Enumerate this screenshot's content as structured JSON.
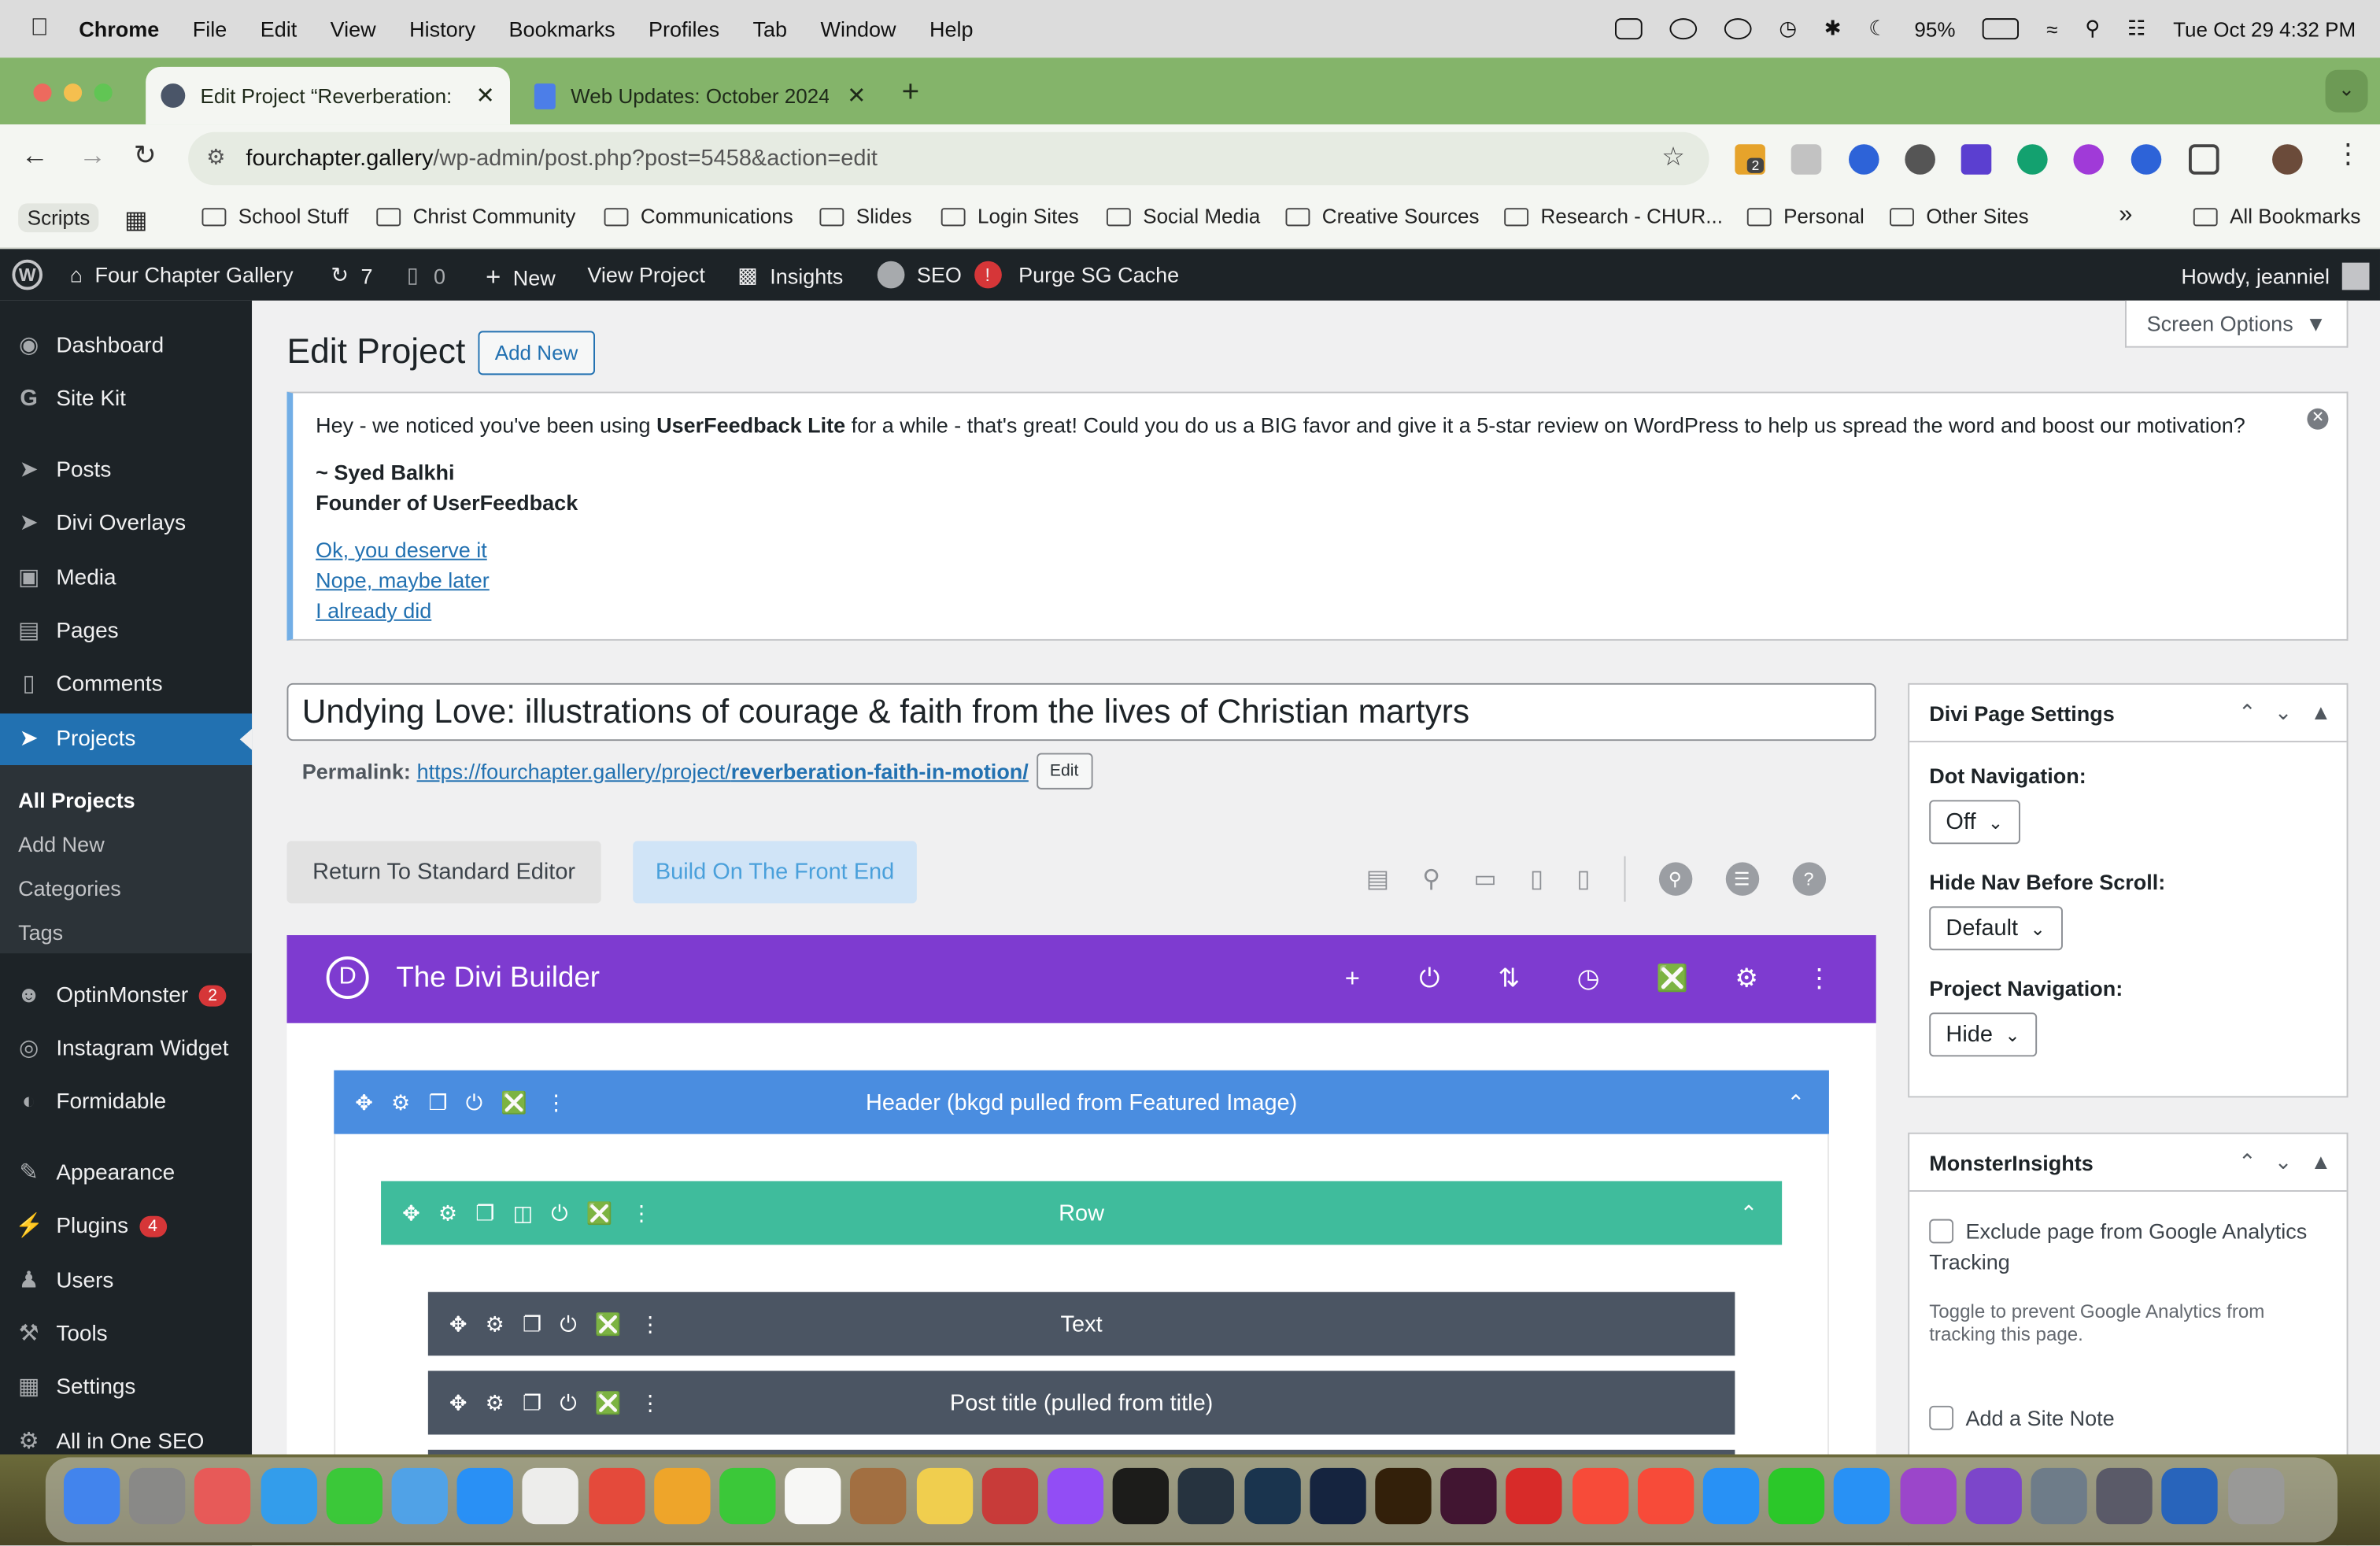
{
  "macos": {
    "app": "Chrome",
    "menus": [
      "File",
      "Edit",
      "View",
      "History",
      "Bookmarks",
      "Profiles",
      "Tab",
      "Window",
      "Help"
    ],
    "battery": "95%",
    "clock": "Tue Oct 29  4:32 PM"
  },
  "browser": {
    "tabs": [
      {
        "title": "Edit Project “Reverberation: F"
      },
      {
        "title": "Web Updates: October 2024"
      }
    ],
    "url_host": "fourchapter.gallery",
    "url_path": "/wp-admin/post.php?post=5458&action=edit",
    "ext_badge": "2",
    "bookmarks": [
      "School Stuff",
      "Christ Community",
      "Communications",
      "Slides",
      "Login Sites",
      "Social Media",
      "Creative Sources",
      "Research - CHUR...",
      "Personal",
      "Other Sites"
    ],
    "scripts_label": "Scripts",
    "more": "»",
    "all_bookmarks": "All Bookmarks"
  },
  "adminbar": {
    "site_name": "Four Chapter Gallery",
    "updates": "7",
    "comments": "0",
    "new": "New",
    "view_project": "View Project",
    "insights": "Insights",
    "seo": "SEO",
    "seo_alert": "!",
    "purge": "Purge SG Cache",
    "howdy": "Howdy, jeanniel"
  },
  "sidebar": {
    "items": [
      {
        "label": "Dashboard",
        "icon": "dashboard-icon"
      },
      {
        "label": "Site Kit",
        "icon": "google-icon"
      },
      {
        "label": "Posts",
        "icon": "pin-icon"
      },
      {
        "label": "Divi Overlays",
        "icon": "pin-icon"
      },
      {
        "label": "Media",
        "icon": "media-icon"
      },
      {
        "label": "Pages",
        "icon": "pages-icon"
      },
      {
        "label": "Comments",
        "icon": "comment-icon"
      },
      {
        "label": "Projects",
        "icon": "pin-icon"
      }
    ],
    "submenu": [
      "All Projects",
      "Add New",
      "Categories",
      "Tags"
    ],
    "items2": [
      {
        "label": "OptinMonster",
        "badge": "2"
      },
      {
        "label": "Instagram Widget"
      },
      {
        "label": "Formidable"
      },
      {
        "label": "Appearance"
      },
      {
        "label": "Plugins",
        "badge": "4"
      },
      {
        "label": "Users"
      },
      {
        "label": "Tools"
      },
      {
        "label": "Settings"
      },
      {
        "label": "All in One SEO"
      }
    ]
  },
  "page": {
    "title": "Edit Project",
    "add_new": "Add New",
    "screen_options": "Screen Options",
    "notice": {
      "pre": "Hey - we noticed you've been using ",
      "strong": "UserFeedback Lite",
      "post": " for a while - that's great! Could you do us a BIG favor and give it a 5-star review on WordPress to help us spread the word and boost our motivation?",
      "sig1": "~ Syed Balkhi",
      "sig2": "Founder of UserFeedback",
      "links": [
        "Ok, you deserve it",
        "Nope, maybe later",
        "I already did"
      ]
    },
    "post_title": "Undying Love: illustrations of courage & faith from the lives of Christian martyrs",
    "permalink_label": "Permalink:",
    "permalink_base": "https://fourchapter.gallery/project/",
    "permalink_slug": "reverberation-faith-in-motion/",
    "edit": "Edit",
    "return_btn": "Return To Standard Editor",
    "build_btn": "Build On The Front End"
  },
  "divi": {
    "title": "The Divi Builder",
    "section_label": "Header (bkgd pulled from Featured Image)",
    "row_label": "Row",
    "modules": [
      "Text",
      "Post title (pulled from title)"
    ],
    "colors": {
      "purple": "#7e3bd0",
      "section": "#4a8de0",
      "row": "#3fbc9c",
      "module": "#4b5563"
    }
  },
  "settings": {
    "title": "Divi Page Settings",
    "dot_nav_label": "Dot Navigation:",
    "dot_nav_value": "Off",
    "hide_nav_label": "Hide Nav Before Scroll:",
    "hide_nav_value": "Default",
    "proj_nav_label": "Project Navigation:",
    "proj_nav_value": "Hide"
  },
  "monster": {
    "title": "MonsterInsights",
    "exclude": "Exclude page from Google Analytics Tracking",
    "toggle_help": "Toggle to prevent Google Analytics from tracking this page.",
    "site_note": "Add a Site Note"
  }
}
